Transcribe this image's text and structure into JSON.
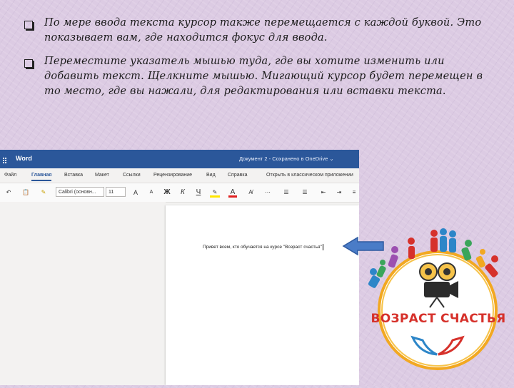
{
  "slide": {
    "bullets": [
      {
        "text": "По мере ввода текста курсор также перемещается с каждой буквой. Это показывает вам, где находится фокус для ввода."
      },
      {
        "text": "Переместите указатель мышью туда, где вы хотите изменить или добавить текст. Щелкните мышью. Мигающий курсор будет перемещен в то место, где вы нажали, для редактирования или вставки текста."
      }
    ]
  },
  "word": {
    "app_name": "Word",
    "doc_title": "Документ 2 - Сохранено в OneDrive ⌄",
    "menu": [
      "Файл",
      "Главная",
      "Вставка",
      "Макет",
      "Ссылки",
      "Рецензирование",
      "Вид",
      "Справка",
      "Открыть в классическом приложении"
    ],
    "font_name": "Calibri (основн...",
    "font_size": "11",
    "bold": "Ж",
    "italic": "К",
    "underline": "Ч",
    "document_text": "Привет всем, кто обучается на курсе \"Возраст счастья\""
  },
  "logo": {
    "title": "ВОЗРАСТ СЧАСТЬЯ"
  },
  "colors": {
    "word_blue": "#2b579a",
    "arrow_blue": "#4a7cc7",
    "logo_red": "#d6312b"
  }
}
